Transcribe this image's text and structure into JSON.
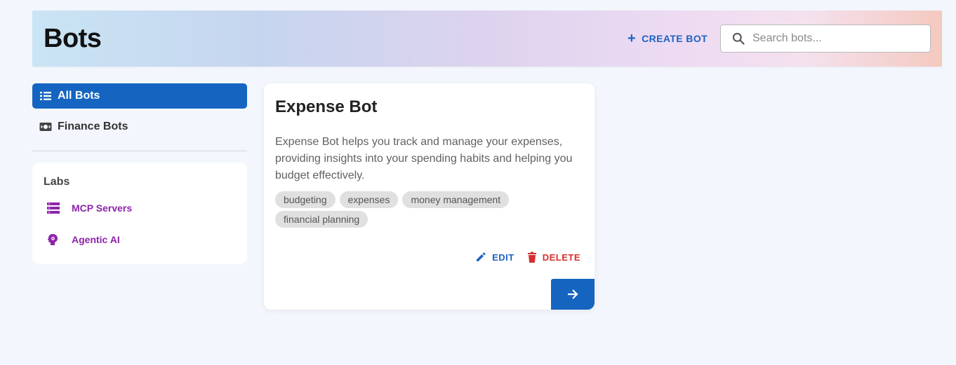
{
  "header": {
    "title": "Bots",
    "create_label": "CREATE BOT",
    "search_placeholder": "Search bots...",
    "search_value": ""
  },
  "sidebar": {
    "items": [
      {
        "label": "All Bots",
        "icon": "list-icon",
        "active": true
      },
      {
        "label": "Finance Bots",
        "icon": "money-icon",
        "active": false
      }
    ],
    "labs": {
      "title": "Labs",
      "items": [
        {
          "label": "MCP Servers",
          "icon": "storage-icon"
        },
        {
          "label": "Agentic AI",
          "icon": "psychology-icon"
        }
      ]
    }
  },
  "bots": [
    {
      "name": "Expense Bot",
      "description": "Expense Bot helps you track and manage your expenses, providing insights into your spending habits and helping you budget effectively.",
      "tags": [
        "budgeting",
        "expenses",
        "money management",
        "financial planning"
      ],
      "edit_label": "EDIT",
      "delete_label": "DELETE"
    }
  ],
  "colors": {
    "primary": "#1565c0",
    "danger": "#d32f2f",
    "labs_accent": "#8e24aa"
  }
}
